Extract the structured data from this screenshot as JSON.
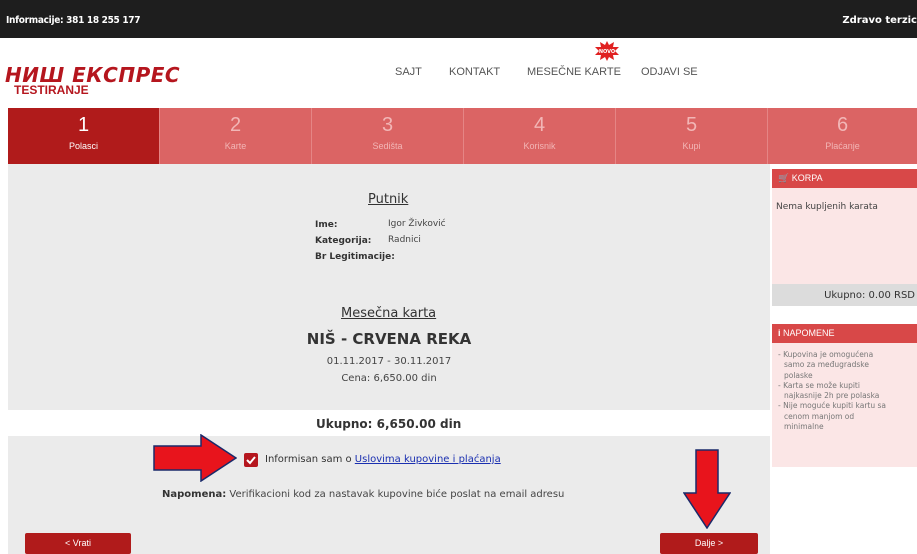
{
  "topbar": {
    "info": "Informacije: 381 18 255 177",
    "greeting": "Zdravo terzic"
  },
  "logo": {
    "main": "НИШ ЕКСПРЕС",
    "sub": "TESTIRANJE"
  },
  "nav": {
    "items": [
      "SAJT",
      "KONTAKT",
      "MESEČNE KARTE",
      "ODJAVI SE"
    ],
    "new_badge": "NOVO"
  },
  "steps": [
    {
      "num": "1",
      "label": "Polasci"
    },
    {
      "num": "2",
      "label": "Karte"
    },
    {
      "num": "3",
      "label": "Sedišta"
    },
    {
      "num": "4",
      "label": "Korisnik"
    },
    {
      "num": "5",
      "label": "Kupi"
    },
    {
      "num": "6",
      "label": "Plaćanje"
    }
  ],
  "active_step": "1",
  "passenger": {
    "title": "Putnik",
    "name_label": "Ime:",
    "name_value": "Igor Živković",
    "category_label": "Kategorija:",
    "category_value": "Radnici",
    "id_label": "Br Legitimacije:"
  },
  "ticket": {
    "title": "Mesečna karta",
    "route": "NIŠ - CRVENA REKA",
    "dates": "01.11.2017 - 30.11.2017",
    "price": "Cena: 6,650.00 din"
  },
  "total": "Ukupno: 6,650.00 din",
  "agreement": {
    "checked": true,
    "text": "Informisan sam o ",
    "link": "Uslovima kupovine i plaćanja"
  },
  "note": {
    "label": "Napomena:",
    "text": " Verifikacioni kod za nastavak kupovine biće poslat na email adresu"
  },
  "buttons": {
    "back": "< Vrati",
    "next": "Dalje >"
  },
  "cart": {
    "title": "KORPA",
    "empty": "Nema kupljenih karata",
    "total": "Ukupno: 0.00 RSD"
  },
  "notices": {
    "title": "NAPOMENE",
    "items": [
      "- Kupovina je omogućena",
      "samo za međugradske",
      "polaske",
      "- Karta se može kupiti",
      "najkasnije 2h pre polaska",
      "- Nije moguće kupiti kartu sa",
      "cenom manjom od",
      "minimalne"
    ]
  },
  "colors": {
    "accent": "#b01b1b",
    "step_bg": "#db6464",
    "arrow": "#e8141c",
    "panel": "#ebebeb"
  }
}
